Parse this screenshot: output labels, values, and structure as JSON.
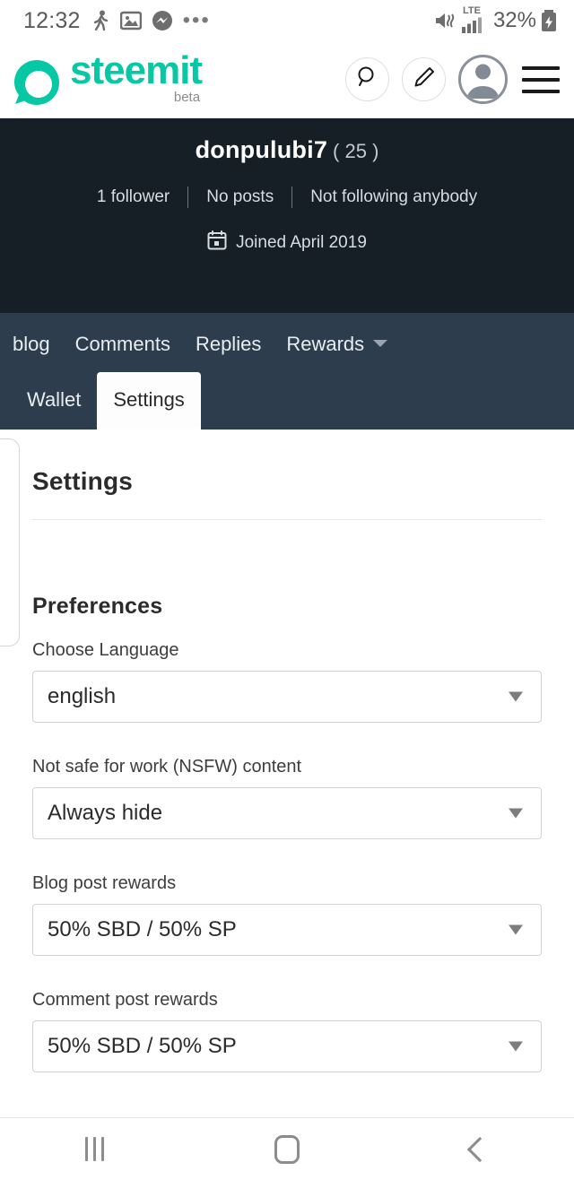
{
  "statusbar": {
    "time": "12:32",
    "icons": [
      "run-tracker-icon",
      "photo-icon",
      "messenger-icon",
      "ellipsis-icon"
    ],
    "mute_icon": "mute-icon",
    "network_label": "LTE",
    "signal_icon": "signal-bars-icon",
    "battery_percent": "32%",
    "battery_icon": "battery-charging-icon"
  },
  "header": {
    "brand_name": "steemit",
    "brand_tag": "beta",
    "brand_color": "#06c8a4",
    "search_icon": "search-icon",
    "compose_icon": "pencil-icon",
    "avatar_icon": "user-avatar-icon",
    "menu_icon": "hamburger-menu-icon"
  },
  "profile": {
    "username": "donpulubi7",
    "reputation": "( 25 )",
    "followers": "1 follower",
    "posts": "No posts",
    "following": "Not following anybody",
    "joined": "Joined April 2019",
    "calendar_icon": "calendar-icon",
    "background_color": "#161e26"
  },
  "tabs": {
    "background_color": "#2d3d4d",
    "row1": [
      {
        "label": "blog",
        "active": false
      },
      {
        "label": "Comments",
        "active": false
      },
      {
        "label": "Replies",
        "active": false
      },
      {
        "label": "Rewards",
        "active": false,
        "caret": true
      }
    ],
    "row2": [
      {
        "label": "Wallet",
        "active": false
      },
      {
        "label": "Settings",
        "active": true
      }
    ]
  },
  "settings": {
    "page_title": "Settings",
    "section_title": "Preferences",
    "fields": [
      {
        "label": "Choose Language",
        "value": "english"
      },
      {
        "label": "Not safe for work (NSFW) content",
        "value": "Always hide"
      },
      {
        "label": "Blog post rewards",
        "value": "50% SBD / 50% SP"
      },
      {
        "label": "Comment post rewards",
        "value": "50% SBD / 50% SP"
      }
    ]
  },
  "navbar": {
    "recents_icon": "recents-icon",
    "home_icon": "home-icon",
    "back_icon": "back-icon"
  }
}
